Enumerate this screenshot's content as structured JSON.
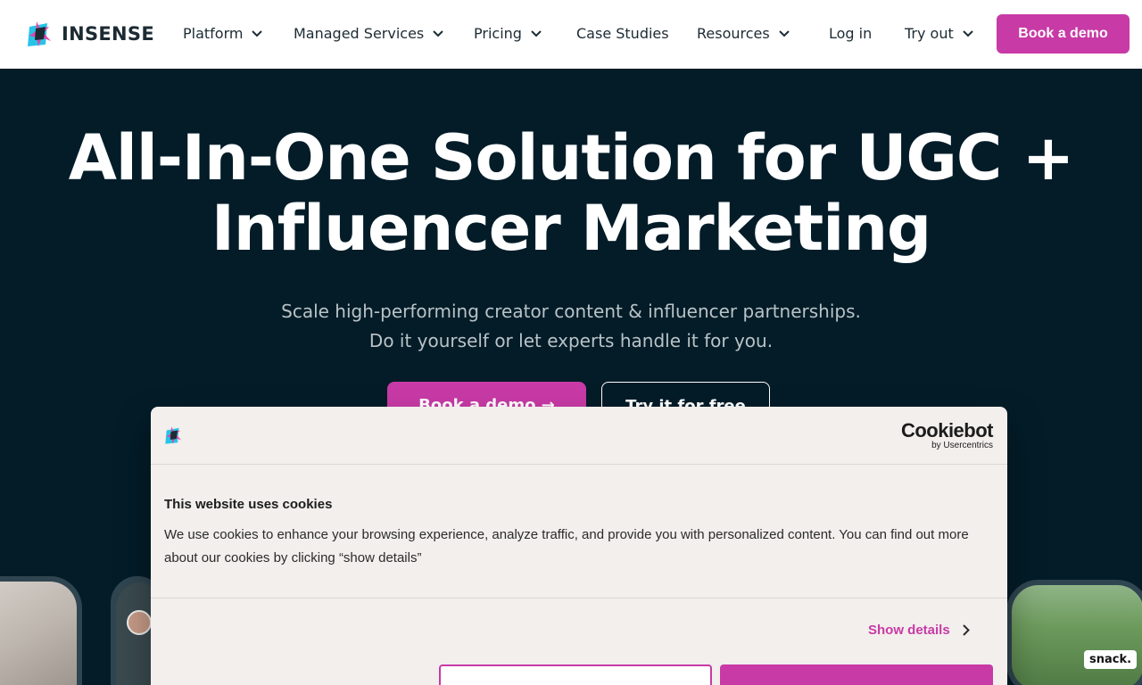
{
  "header": {
    "logo_text": "INSENSE",
    "nav": [
      {
        "label": "Platform",
        "has_dropdown": true
      },
      {
        "label": "Managed Services",
        "has_dropdown": true
      },
      {
        "label": "Pricing",
        "has_dropdown": true
      },
      {
        "label": "Case Studies",
        "has_dropdown": false
      },
      {
        "label": "Resources",
        "has_dropdown": true
      },
      {
        "label": "Log in",
        "has_dropdown": false
      },
      {
        "label": "Try out",
        "has_dropdown": true
      }
    ],
    "cta_label": "Book a demo"
  },
  "hero": {
    "title_line1": "All-In-One Solution for UGC +",
    "title_line2": "Influencer Marketing",
    "subtitle_line1": "Scale high-performing creator content & influencer partnerships.",
    "subtitle_line2": "Do it yourself or let experts handle it for you.",
    "primary_cta": "Book a demo →",
    "secondary_cta": "Try it for free"
  },
  "media": {
    "snack_badge": "snack."
  },
  "cookie_dialog": {
    "brand_main": "Cookiebot",
    "brand_sub": "by Usercentrics",
    "title": "This website uses cookies",
    "body": "We use cookies to enhance your browsing experience, analyze traffic, and provide you with personalized content. You can find out more about our cookies by clicking “show details”",
    "show_details": "Show details"
  },
  "colors": {
    "accent": "#c83aa6",
    "hero_bg": "#031c28",
    "logo_cyan": "#27c4e8",
    "logo_pink": "#e83fa6"
  }
}
